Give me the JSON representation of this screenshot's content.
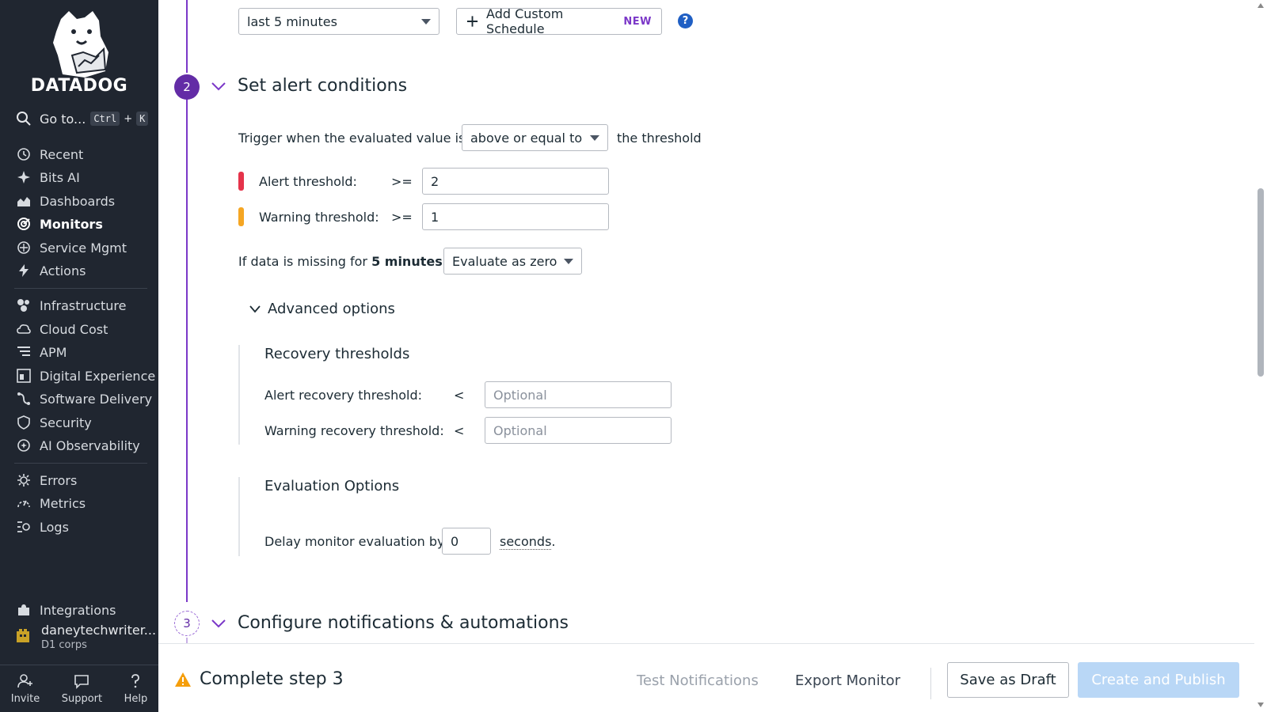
{
  "sidebar": {
    "brand": "DATADOG",
    "goto": {
      "label": "Go to...",
      "key1": "Ctrl",
      "plus": "+",
      "key2": "K"
    },
    "items": [
      {
        "label": "Recent",
        "icon": "history-icon"
      },
      {
        "label": "Bits AI",
        "icon": "sparkle-icon"
      },
      {
        "label": "Dashboards",
        "icon": "dashboard-icon"
      },
      {
        "label": "Monitors",
        "icon": "monitor-icon",
        "active": true
      },
      {
        "label": "Service Mgmt",
        "icon": "service-icon"
      },
      {
        "label": "Actions",
        "icon": "bolt-icon"
      },
      {
        "label": "Infrastructure",
        "icon": "infrastructure-icon"
      },
      {
        "label": "Cloud Cost",
        "icon": "cloud-cost-icon"
      },
      {
        "label": "APM",
        "icon": "apm-icon"
      },
      {
        "label": "Digital Experience",
        "icon": "digital-experience-icon"
      },
      {
        "label": "Software Delivery",
        "icon": "software-delivery-icon"
      },
      {
        "label": "Security",
        "icon": "shield-icon"
      },
      {
        "label": "AI Observability",
        "icon": "ai-observability-icon"
      },
      {
        "label": "Errors",
        "icon": "bug-icon"
      },
      {
        "label": "Metrics",
        "icon": "gauge-icon"
      },
      {
        "label": "Logs",
        "icon": "logs-icon"
      },
      {
        "label": "Integrations",
        "icon": "puzzle-icon"
      }
    ],
    "user": {
      "name": "daneytechwriter...",
      "org": "D1 corps"
    },
    "bottom": {
      "invite": "Invite",
      "support": "Support",
      "help": "Help"
    }
  },
  "step1": {
    "time_select": "last 5 minutes",
    "add_schedule": "Add Custom Schedule",
    "new_badge": "NEW",
    "help_glyph": "?"
  },
  "step2": {
    "number": "2",
    "title": "Set alert conditions",
    "trigger_prefix": "Trigger when the evaluated value is",
    "trigger_select": "above or equal to",
    "trigger_suffix": "the threshold",
    "alert_label": "Alert threshold:",
    "alert_op": ">=",
    "alert_value": "2",
    "warning_label": "Warning threshold:",
    "warning_op": ">=",
    "warning_value": "1",
    "missing_prefix": "If data is missing for",
    "missing_duration": "5 minutes",
    "missing_select": "Evaluate as zero",
    "advanced_label": "Advanced options",
    "recovery_title": "Recovery thresholds",
    "alert_recovery_label": "Alert recovery threshold:",
    "alert_recovery_op": "<",
    "warning_recovery_label": "Warning recovery threshold:",
    "warning_recovery_op": "<",
    "optional_placeholder": "Optional",
    "eval_title": "Evaluation Options",
    "delay_label": "Delay monitor evaluation by",
    "delay_value": "0",
    "delay_unit": "seconds",
    "delay_period": "."
  },
  "step3": {
    "number": "3",
    "title": "Configure notifications & automations"
  },
  "footer": {
    "status": "Complete step 3",
    "test_notifications": "Test Notifications",
    "export_monitor": "Export Monitor",
    "save_draft": "Save as Draft",
    "create_publish": "Create and Publish"
  },
  "colors": {
    "brand_purple": "#632ca6",
    "alert_red": "#e5334a",
    "warning_orange": "#f5a623",
    "sidebar_bg": "#202630",
    "publish_disabled": "#b9d7f6"
  }
}
